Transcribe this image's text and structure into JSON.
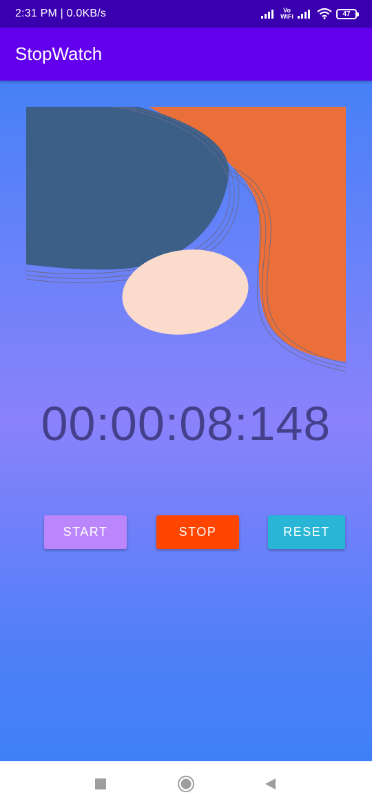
{
  "status_bar": {
    "time_speed": "2:31 PM | 0.0KB/s",
    "vowifi_top": "Vo",
    "vowifi_bottom": "WiFi",
    "battery": "47"
  },
  "app": {
    "title": "StopWatch"
  },
  "stopwatch": {
    "time": "00:00:08:148"
  },
  "buttons": {
    "start": "START",
    "stop": "STOP",
    "reset": "RESET"
  },
  "colors": {
    "status_bar": "#3a00b0",
    "app_bar": "#6200ee",
    "start_button": "#bb86fc",
    "stop_button": "#ff4500",
    "reset_button": "#29b6d6",
    "time_text": "#45408c",
    "shape_dark": "#3c5f88",
    "shape_orange": "#ea6f38",
    "shape_peach": "#fbdbcb"
  },
  "nav_bar": {
    "icons": [
      "recents-square-icon",
      "home-circle-icon",
      "back-triangle-icon"
    ]
  }
}
